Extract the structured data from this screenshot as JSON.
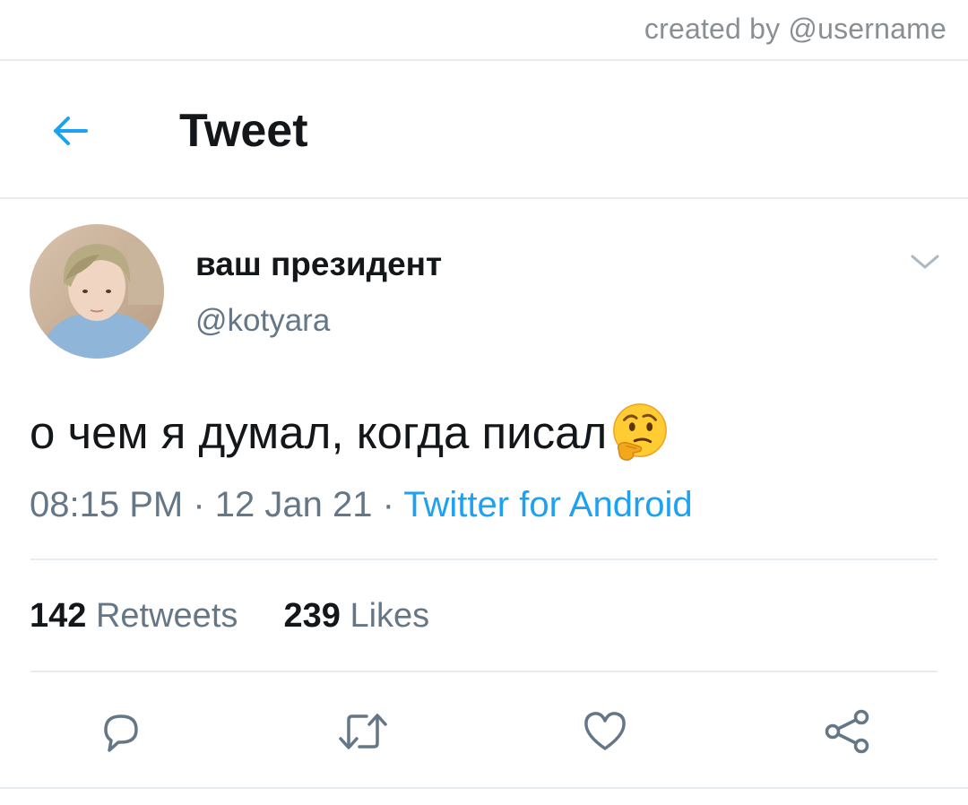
{
  "watermark": "created by @username",
  "header": {
    "title": "Tweet",
    "back_icon": "arrow-left-icon"
  },
  "tweet": {
    "display_name": "ваш президент",
    "handle": "@kotyara",
    "text": "о чем я думал, когда писал",
    "emoji": "thinking-face-emoji",
    "time": "08:15 PM",
    "separator": " · ",
    "date": "12 Jan 21",
    "source": "Twitter for Android",
    "retweets_count": "142",
    "retweets_label": "Retweets",
    "likes_count": "239",
    "likes_label": "Likes"
  },
  "actions": [
    "reply-icon",
    "retweet-icon",
    "like-icon",
    "share-icon"
  ],
  "colors": {
    "accent": "#1da1f2",
    "text_primary": "#14171a",
    "text_secondary": "#657786",
    "divider": "#e6ecf0",
    "icon": "#657786"
  }
}
